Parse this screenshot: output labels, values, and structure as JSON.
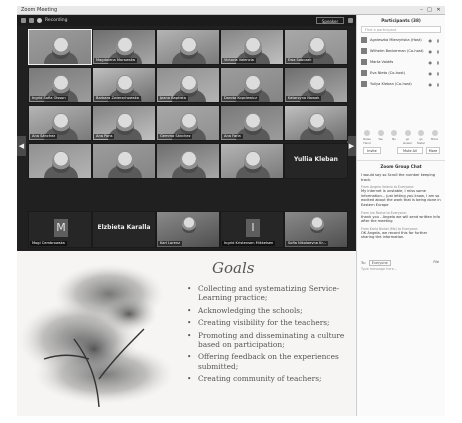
{
  "window": {
    "title": "Zoom Meeting",
    "minimize": "–",
    "maximize": "□",
    "close": "✕"
  },
  "toolbar": {
    "recording": "Recording",
    "view_button": "Speaker View"
  },
  "tiles": [
    {
      "name": "",
      "kind": "video"
    },
    {
      "name": "Magdalena Morawska",
      "kind": "video"
    },
    {
      "name": "",
      "kind": "video"
    },
    {
      "name": "Victoria Valencia",
      "kind": "video"
    },
    {
      "name": "Ewa Sobczak",
      "kind": "video"
    },
    {
      "name": "Ingrid Sofia Olsson",
      "kind": "video"
    },
    {
      "name": "Barbara Zwierzchowska",
      "kind": "video"
    },
    {
      "name": "Joana Baptista",
      "kind": "video"
    },
    {
      "name": "Dorota Kopciewicz",
      "kind": "video"
    },
    {
      "name": "Katarzyna Nowak",
      "kind": "video"
    },
    {
      "name": "Ana Sánchez",
      "kind": "video"
    },
    {
      "name": "Ana Pons",
      "kind": "video"
    },
    {
      "name": "Gemma Sánchez",
      "kind": "video"
    },
    {
      "name": "Ana Faria",
      "kind": "video"
    },
    {
      "name": "",
      "kind": "video"
    },
    {
      "name": "",
      "kind": "video"
    },
    {
      "name": "",
      "kind": "video"
    },
    {
      "name": "",
      "kind": "video"
    },
    {
      "name": "",
      "kind": "video"
    },
    {
      "name": "Yullia Kleban",
      "kind": "label"
    }
  ],
  "bottom_tiles": [
    {
      "letter": "M",
      "big": "",
      "name": "Mogi Cembrowska"
    },
    {
      "letter": "",
      "big": "Elzbieta Karalla",
      "name": ""
    },
    {
      "letter": "",
      "big": "",
      "name": "Karl Lorenz"
    },
    {
      "letter": "I",
      "big": "",
      "name": "Ingrid Kristensen Mikkelsen"
    },
    {
      "letter": "",
      "big": "",
      "name": "Sofia Nikolaevna Kr..."
    }
  ],
  "slide": {
    "title": "Goals",
    "bullet_char": "•",
    "bullets": [
      "Collecting and systematizing Service-Learning practice;",
      "Acknowledging the schools;",
      "Creating visibility for the teachers;",
      "Promoting and disseminating a culture based on participation;",
      "Offering feedback on the experiences submitted;",
      "Creating community of teachers;"
    ]
  },
  "participants": {
    "title": "Participants (38)",
    "search_placeholder": "Find a participant",
    "list": [
      "Agnieszka Mierzyńska (Host)",
      "Wilhelm Beckerman (Co-host)",
      "Marta Valdés",
      "Eva Nieto (Co-host)",
      "Yuliya Kleban (Co-host)"
    ],
    "reactions": [
      "Raise Hand",
      "Yes",
      "No",
      "go slower",
      "go faster",
      "More"
    ],
    "invite": "Invite",
    "mute_all": "Mute All",
    "more": "More"
  },
  "chat": {
    "title": "Zoom Group Chat",
    "messages": [
      {
        "from": "",
        "text": "I would say so Scroll the number keeping track."
      },
      {
        "from": "From Angela Valerio to Everyone:",
        "text": "My internet is unstable, I miss some information... just letting you know, I am so excited about the work that is being done in Eastern Europe"
      },
      {
        "from": "From Ivo Rocha to Everyone:",
        "text": "thank you - Angela we will send written info after the meeting"
      },
      {
        "from": "From Karla Nickel (Me) to Everyone:",
        "text": "OK Angela, we record this for further sharing the information."
      }
    ],
    "to_label": "To:",
    "to_value": "Everyone",
    "file": "File",
    "input_placeholder": "Type message here..."
  }
}
